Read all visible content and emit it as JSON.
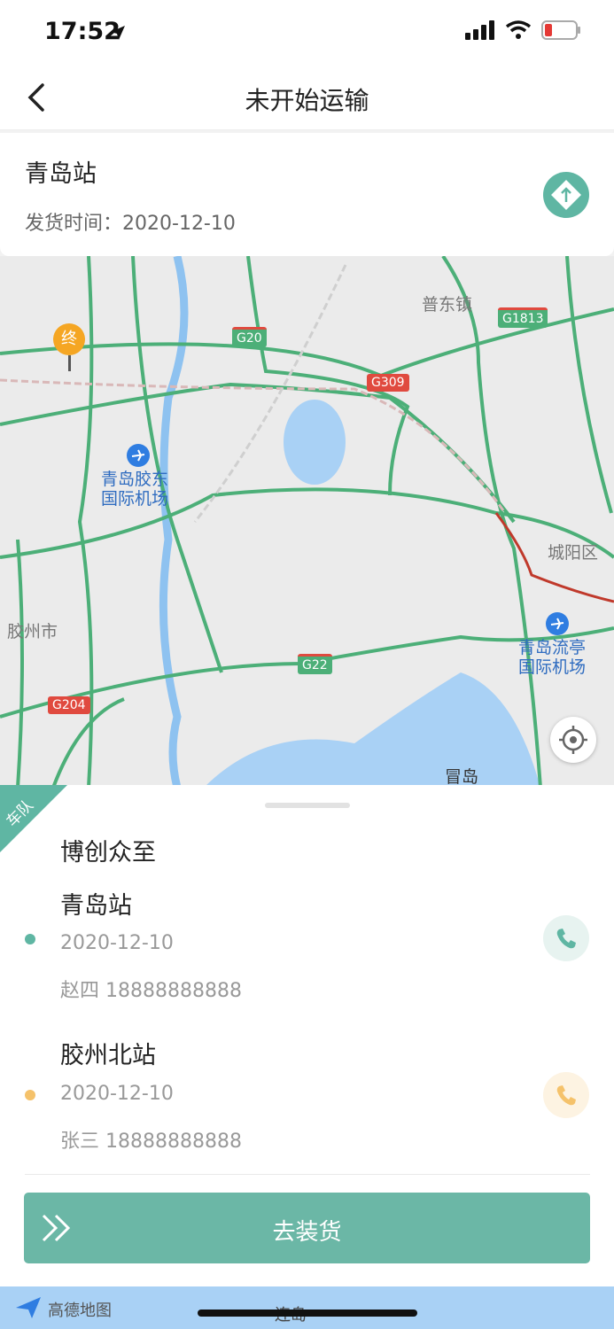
{
  "status": {
    "time": "17:52"
  },
  "nav": {
    "title": "未开始运输"
  },
  "info": {
    "title": "青岛站",
    "ship_time_label": "发货时间：",
    "ship_time": "2020-12-10"
  },
  "map": {
    "labels": [
      "普东镇",
      "青岛胶东\n国际机场",
      "城阳区",
      "胶州市",
      "青岛流亭\n国际机场",
      "冒岛"
    ],
    "road_signs": [
      "G1813",
      "G20",
      "G309",
      "G22",
      "G204"
    ],
    "end_marker": "终"
  },
  "sheet": {
    "tag": "车队",
    "company": "博创众至",
    "stops": [
      {
        "name": "青岛站",
        "date": "2020-12-10",
        "contact": "赵四 18888888888",
        "color": "#5fb6a3"
      },
      {
        "name": "胶州北站",
        "date": "2020-12-10",
        "contact": "张三 18888888888",
        "color": "#f5c26b"
      }
    ],
    "action_label": "去装货"
  },
  "footer": {
    "map_logo": "高德地图",
    "bottom_label": "连岛"
  },
  "colors": {
    "accent": "#5fb6a3",
    "button": "#6bb7a6",
    "road": "#4caf78"
  }
}
